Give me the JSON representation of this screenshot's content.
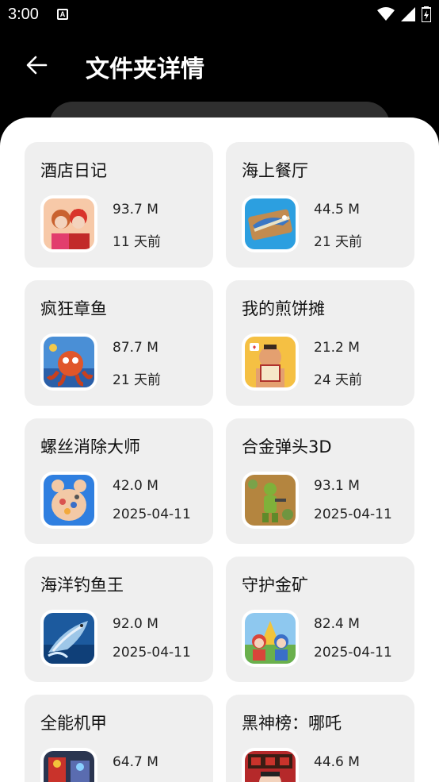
{
  "status_bar": {
    "time": "3:00",
    "notification_letter": "A"
  },
  "header": {
    "title": "文件夹详情"
  },
  "files": [
    {
      "name": "酒店日记",
      "size": "93.7 M",
      "date": "11 天前",
      "icon": "hotel-diary-app-icon"
    },
    {
      "name": "海上餐厅",
      "size": "44.5 M",
      "date": "21 天前",
      "icon": "sea-restaurant-app-icon"
    },
    {
      "name": "疯狂章鱼",
      "size": "87.7 M",
      "date": "21 天前",
      "icon": "crazy-octopus-app-icon"
    },
    {
      "name": "我的煎饼摊",
      "size": "21.2 M",
      "date": "24 天前",
      "icon": "pancake-stall-app-icon"
    },
    {
      "name": "螺丝消除大师",
      "size": "42.0 M",
      "date": "2025-04-11",
      "icon": "screw-master-app-icon"
    },
    {
      "name": "合金弹头3D",
      "size": "93.1 M",
      "date": "2025-04-11",
      "icon": "metal-slug-app-icon"
    },
    {
      "name": "海洋钓鱼王",
      "size": "92.0 M",
      "date": "2025-04-11",
      "icon": "fishing-king-app-icon"
    },
    {
      "name": "守护金矿",
      "size": "82.4 M",
      "date": "2025-04-11",
      "icon": "guard-gold-mine-app-icon"
    },
    {
      "name": "全能机甲",
      "size": "64.7 M",
      "date": "",
      "icon": "mecha-app-icon"
    },
    {
      "name": "黑神榜：哪吒",
      "size": "44.6 M",
      "date": "",
      "icon": "nezha-app-icon"
    }
  ]
}
